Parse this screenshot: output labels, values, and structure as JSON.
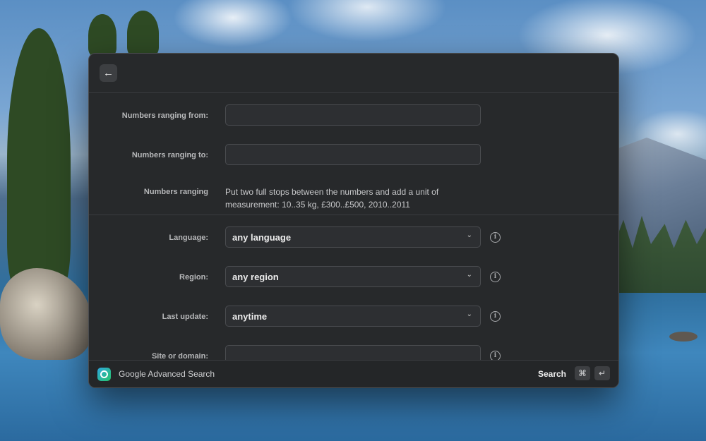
{
  "header": {
    "back_icon": "arrow-left-icon",
    "back_glyph": "←"
  },
  "form": {
    "numbers_from_label": "Numbers ranging from:",
    "numbers_from_value": "",
    "numbers_to_label": "Numbers ranging to:",
    "numbers_to_value": "",
    "numbers_hint_label": "Numbers ranging",
    "numbers_hint_text": "Put two full stops between the numbers and add a unit of measurement: 10..35 kg, £300..£500, 2010..2011",
    "language_label": "Language:",
    "language_value": "any language",
    "region_label": "Region:",
    "region_value": "any region",
    "last_update_label": "Last update:",
    "last_update_value": "anytime",
    "site_label": "Site or domain:",
    "site_value": "",
    "chevron_glyph": "⌄",
    "info_glyph": "i"
  },
  "footer": {
    "app_name": "Google Advanced Search",
    "action_label": "Search",
    "shortcut_keys": [
      "⌘",
      "↵"
    ]
  }
}
